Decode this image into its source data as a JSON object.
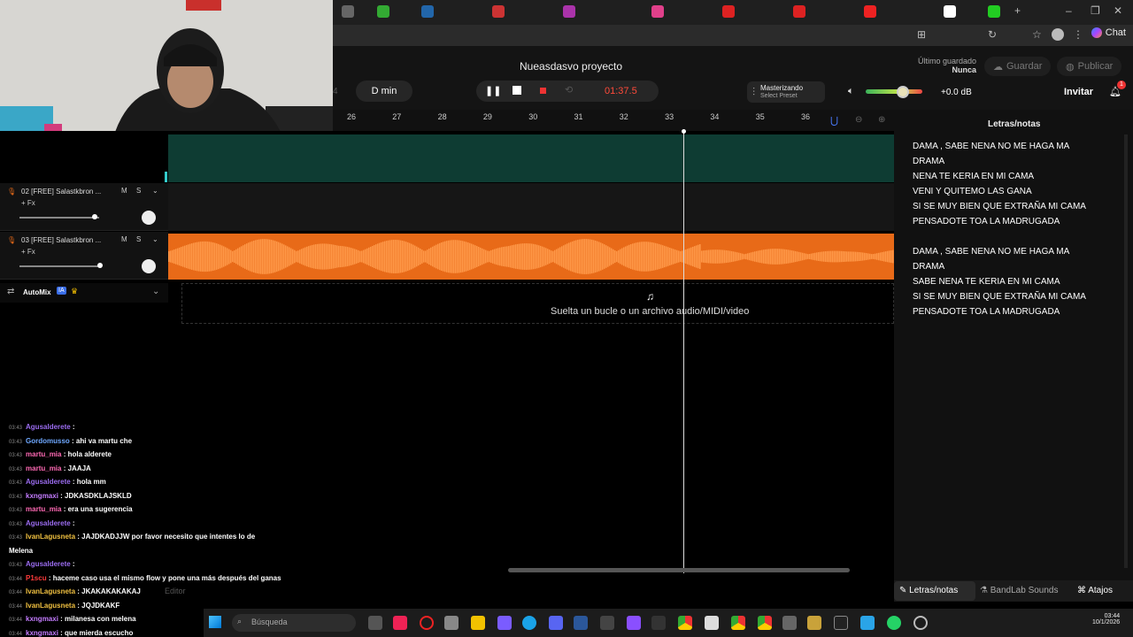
{
  "project": {
    "title": "Nueasdasvo proyecto",
    "key": "D min",
    "time": "01:37.5",
    "partial_left": "4"
  },
  "header": {
    "last_saved_label": "Último guardado",
    "last_saved_value": "Nunca",
    "save_label": "Guardar",
    "publish_label": "Publicar",
    "invite_label": "Invitar",
    "notification_count": "1",
    "master_label": "Masterizando",
    "master_preset": "Select Preset",
    "volume_db": "+0.0 dB",
    "volume_level_fraction": 0.6
  },
  "browser": {
    "chat_label": "Chat"
  },
  "ruler": [
    "26",
    "27",
    "28",
    "29",
    "30",
    "31",
    "32",
    "33",
    "34",
    "35",
    "36"
  ],
  "tracks": [
    {
      "name": "02 [FREE] Salastkbron ...",
      "mute": "M",
      "solo": "S",
      "fx": "+ Fx"
    },
    {
      "name": "03 [FREE] Salastkbron ...",
      "mute": "M",
      "solo": "S",
      "fx": "+ Fx"
    }
  ],
  "automix": {
    "label": "AutoMix",
    "badge": "IA"
  },
  "drop_text": "Suelta un bucle o un archivo audio/MIDI/video",
  "lyrics": {
    "title": "Letras/notas",
    "lines": [
      "DAMA , SABE NENA NO ME HAGA MA",
      "DRAMA",
      "NENA TE KERIA EN MI CAMA",
      "VENI Y QUITEMO LAS GANA",
      "SI SE MUY BIEN QUE EXTRAÑA MI CAMA",
      "PENSADOTE TOA LA MADRUGADA",
      "DAMA , SABE NENA NO ME HAGA MA",
      "DRAMA",
      "SABE NENA TE KERIA EN MI CAMA",
      "SI SE MUY BIEN QUE EXTRAÑA MI CAMA",
      "PENSADOTE TOA LA MADRUGADA"
    ]
  },
  "bottom_tabs": {
    "lyrics": "Letras/notas",
    "sounds": "BandLab Sounds",
    "shortcuts": "Atajos",
    "editor": "Editor"
  },
  "chat": [
    {
      "time": "03:43",
      "user": "Agusalderete",
      "color": "#9b6cf0",
      "msg": ":"
    },
    {
      "time": "03:43",
      "user": "Gordomusso",
      "color": "#6fa8ff",
      "msg": ": ahi va martu che"
    },
    {
      "time": "03:43",
      "user": "martu_mia",
      "color": "#ff69b4",
      "msg": ": hola alderete"
    },
    {
      "time": "03:43",
      "user": "martu_mia",
      "color": "#ff69b4",
      "msg": ": JAAJA"
    },
    {
      "time": "03:43",
      "user": "Agusalderete",
      "color": "#9b6cf0",
      "msg": ": hola mm"
    },
    {
      "time": "03:43",
      "user": "kxngmaxi",
      "color": "#c47cff",
      "msg": ": JDKASDKLAJSKLD"
    },
    {
      "time": "03:43",
      "user": "martu_mia",
      "color": "#ff69b4",
      "msg": ": era una sugerencia"
    },
    {
      "time": "03:43",
      "user": "Agusalderete",
      "color": "#9b6cf0",
      "msg": ":"
    },
    {
      "time": "03:43",
      "user": "IvanLagusneta",
      "color": "#f0c040",
      "msg": ": JAJDKADJJW por favor necesito que intentes lo de"
    },
    {
      "time": "",
      "user": "",
      "color": "#fff",
      "msg": "Melena"
    },
    {
      "time": "03:43",
      "user": "Agusalderete",
      "color": "#9b6cf0",
      "msg": ":"
    },
    {
      "time": "03:44",
      "user": "P1scu",
      "color": "#ff3b3b",
      "msg": ": haceme caso usa el mismo flow y pone una más después del ganas"
    },
    {
      "time": "03:44",
      "user": "IvanLagusneta",
      "color": "#f0c040",
      "msg": ": JKAKAKAKAKAJ"
    },
    {
      "time": "03:44",
      "user": "IvanLagusneta",
      "color": "#f0c040",
      "msg": ": JQJDKAKF"
    },
    {
      "time": "03:44",
      "user": "kxngmaxi",
      "color": "#c47cff",
      "msg": ": milanesa con melena"
    },
    {
      "time": "03:44",
      "user": "kxngmaxi",
      "color": "#c47cff",
      "msg": ": que mierda escucho"
    }
  ],
  "taskbar": {
    "search": "Búsqueda",
    "time": "03:44",
    "date": "10/1/2026"
  },
  "colors": {
    "accent_orange": "#e86a18",
    "teal_track": "#0e3c33",
    "time_red": "#ff4a3a"
  }
}
